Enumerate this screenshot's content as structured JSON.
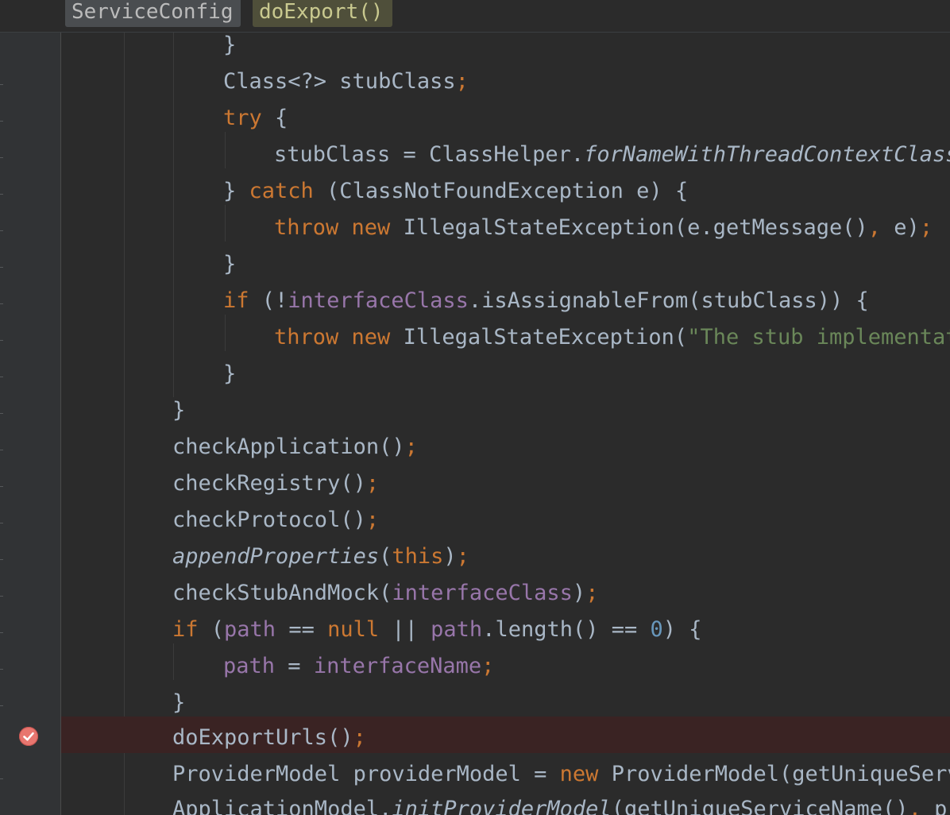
{
  "breadcrumb": {
    "class_name": "ServiceConfig",
    "method_name": "doExport()"
  },
  "code": {
    "l1": {
      "a": "}"
    },
    "l2": {
      "a": "Class<?> stubClass",
      "b": ";"
    },
    "l3": {
      "a": "try",
      "b": " {"
    },
    "l4": {
      "a": "stubClass = ClassHelper.",
      "b": "forNameWithThreadContextClassL"
    },
    "l5": {
      "a": "} ",
      "b": "catch",
      "c": " (ClassNotFoundException e) {"
    },
    "l6": {
      "a": "throw new",
      "b": " IllegalStateException(e.getMessage()",
      "c": ",",
      "d": " e)",
      "e": ";"
    },
    "l7": {
      "a": "}"
    },
    "l8": {
      "a": "if",
      "b": " (!",
      "c": "interfaceClass",
      "d": ".isAssignableFrom(stubClass)) {"
    },
    "l9": {
      "a": "throw new",
      "b": " IllegalStateException(",
      "c": "\"The stub implementati"
    },
    "l10": {
      "a": "}"
    },
    "l11": {
      "a": "}"
    },
    "l12": {
      "a": "checkApplication()",
      "b": ";"
    },
    "l13": {
      "a": "checkRegistry()",
      "b": ";"
    },
    "l14": {
      "a": "checkProtocol()",
      "b": ";"
    },
    "l15": {
      "a": "appendProperties",
      "b": "(",
      "c": "this",
      "d": ")",
      "e": ";"
    },
    "l16": {
      "a": "checkStubAndMock(",
      "b": "interfaceClass",
      "c": ")",
      "d": ";"
    },
    "l17": {
      "a": "if",
      "b": " (",
      "c": "path",
      "d": " == ",
      "e": "null",
      "f": " || ",
      "g": "path",
      "h": ".length() == ",
      "i": "0",
      "j": ") {"
    },
    "l18": {
      "a": "path",
      "b": " = ",
      "c": "interfaceName",
      "d": ";"
    },
    "l19": {
      "a": "}"
    },
    "l20": {
      "a": "doExportUrls()",
      "b": ";"
    },
    "l21": {
      "a": "ProviderModel providerModel = ",
      "b": "new",
      "c": " ProviderModel(getUniqueServi"
    },
    "l22": {
      "a": "ApplicationModel.",
      "b": "initProviderModel",
      "c": "(getUniqueServiceName()",
      "d": ",",
      "e": " pro"
    }
  },
  "gutter": {
    "breakpoint_icon": "breakpoint-check-icon"
  },
  "colors": {
    "background": "#2b2b2b",
    "keyword": "#cc7832",
    "field": "#9876aa",
    "string": "#6a8759",
    "number": "#6897bb",
    "text": "#a9b7c6",
    "breakpoint_line": "#3a2323",
    "breakpoint": "#e8766f"
  }
}
